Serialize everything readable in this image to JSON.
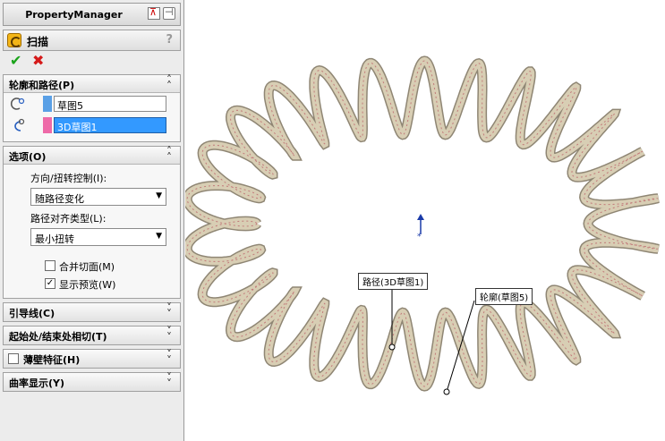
{
  "panel": {
    "title": "PropertyManager",
    "feature_name": "扫描",
    "help": "?",
    "ok": "✔",
    "cancel": "✖"
  },
  "groups": {
    "profile_path": {
      "title": "轮廓和路径(P)",
      "profile_value": "草图5",
      "path_value": "3D草图1"
    },
    "options": {
      "title": "选项(O)",
      "orientation_label": "方向/扭转控制(I):",
      "orientation_value": "随路径变化",
      "alignment_label": "路径对齐类型(L):",
      "alignment_value": "最小扭转",
      "merge_label": "合并切面(M)",
      "merge_checked": false,
      "preview_label": "显示预览(W)",
      "preview_checked": true
    },
    "guide": {
      "title": "引导线(C)"
    },
    "tangency": {
      "title": "起始处/结束处相切(T)"
    },
    "thin": {
      "title": "薄壁特征(H)",
      "checked": false
    },
    "curvature": {
      "title": "曲率显示(Y)"
    }
  },
  "viewport": {
    "path_callout": "路径(3D草图1)",
    "profile_callout": "轮廓(草图5)"
  },
  "colors": {
    "profile_swatch": "#5aa0e6",
    "path_swatch": "#ee6aa8",
    "coil": "#d8ceb4",
    "selection": "#3399ff"
  }
}
